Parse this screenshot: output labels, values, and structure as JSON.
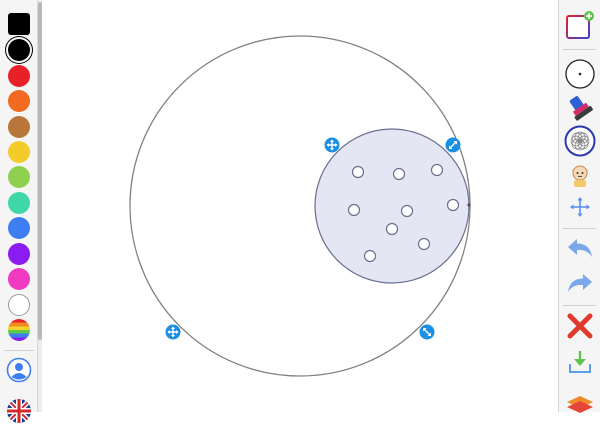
{
  "palette": {
    "colors": [
      {
        "name": "black-square",
        "hex": "#000000"
      },
      {
        "name": "black",
        "hex": "#000000"
      },
      {
        "name": "red",
        "hex": "#e8202a"
      },
      {
        "name": "orange",
        "hex": "#f26a22"
      },
      {
        "name": "brown",
        "hex": "#b8763a"
      },
      {
        "name": "yellow",
        "hex": "#f4cc2a"
      },
      {
        "name": "light-green",
        "hex": "#8fd14f"
      },
      {
        "name": "teal",
        "hex": "#3fd6a8"
      },
      {
        "name": "blue",
        "hex": "#3d7ff2"
      },
      {
        "name": "purple",
        "hex": "#8a1cf2"
      },
      {
        "name": "magenta",
        "hex": "#f03ac0"
      },
      {
        "name": "white",
        "hex": "#ffffff"
      },
      {
        "name": "rainbow",
        "hex": "rainbow"
      }
    ],
    "selected": "black"
  },
  "colors": {
    "accent": "#1a8fe3",
    "circle_stroke": "#808080",
    "inner_fill": "#e4e6f4",
    "inner_stroke": "#6a6f8f"
  },
  "icons": {
    "left_bottom": [
      "user-profile-icon",
      "uk-flag-icon"
    ],
    "right_toolbar": [
      "new-page-icon",
      "dot-tool-icon",
      "rubber-stamp-icon",
      "spirograph-icon",
      "character-icon",
      "move-icon",
      "undo-icon",
      "redo-icon",
      "delete-icon",
      "download-icon",
      "layers-icon"
    ],
    "handles": [
      "move-handle-icon",
      "resize-handle-icon"
    ]
  }
}
